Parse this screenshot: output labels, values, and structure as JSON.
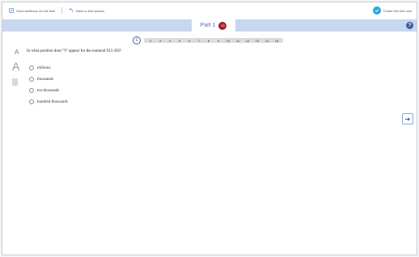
{
  "topbar": {
    "feedback_label": "Send feedback on this item",
    "options_label": "Back to test options",
    "create_label": "Create this test now"
  },
  "part": {
    "label": "Part 1",
    "count": "15"
  },
  "questions": {
    "current": "1",
    "numbers": [
      "2",
      "3",
      "4",
      "5",
      "6",
      "7",
      "8",
      "9",
      "10",
      "11",
      "12",
      "13",
      "14",
      "15"
    ]
  },
  "tools": {
    "a_small": "A",
    "a_large": "A"
  },
  "question": {
    "text": "In what position does \"9\" appear for the numeral 913 456?",
    "options": [
      "millions",
      "thousands",
      "ten thousands",
      "hundred thousands"
    ]
  },
  "icons": {
    "help": "?",
    "next": "➔"
  },
  "colors": {
    "accent": "#3d5f9e",
    "part_bar": "#c8d6ef",
    "count_badge": "#a5202c",
    "check": "#2aa8df"
  }
}
